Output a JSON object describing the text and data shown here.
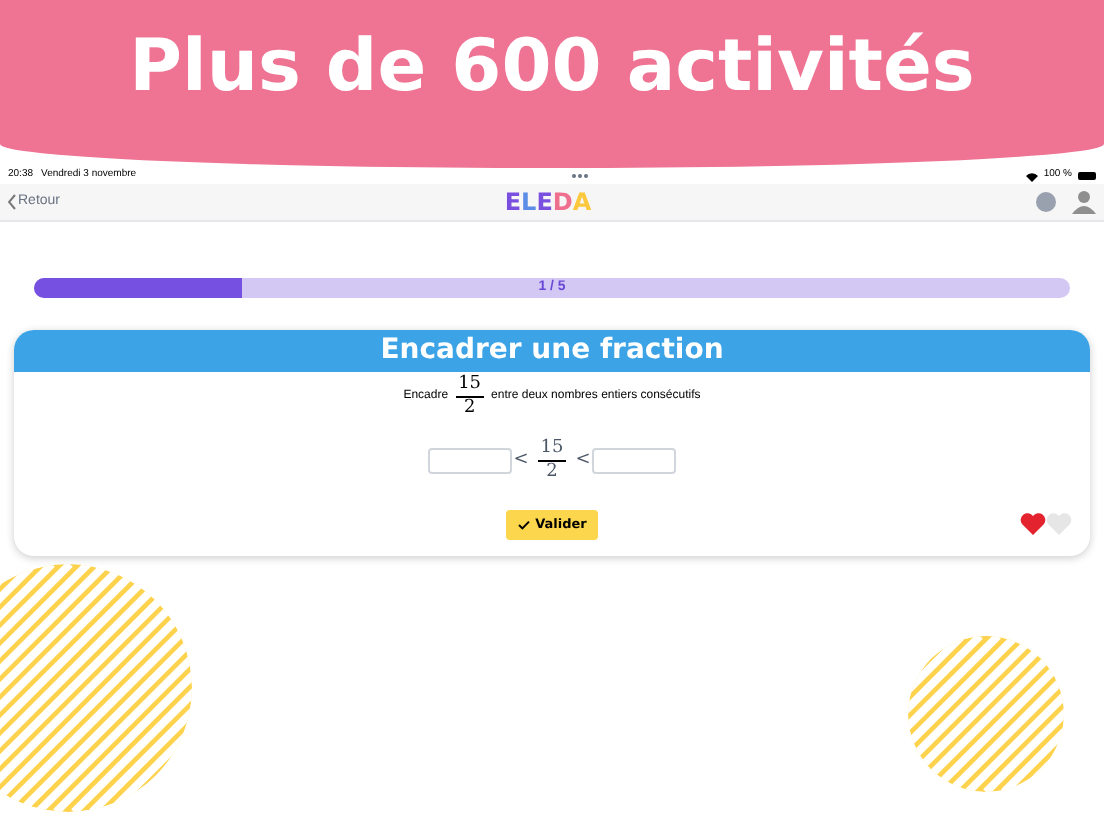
{
  "banner": {
    "title": "Plus de 600 activités"
  },
  "status_bar": {
    "time": "20:38",
    "date": "Vendredi 3 novembre",
    "battery": "100 %"
  },
  "nav": {
    "back": "Retour",
    "logo": "ELEDA"
  },
  "progress": {
    "label": "1 / 5",
    "level": 0.2
  },
  "card": {
    "title": "Encadrer une fraction",
    "instruction": {
      "before": "Encadre",
      "fraction": {
        "numerator": "15",
        "denominator": "2"
      },
      "after": "entre deux nombres entiers consécutifs"
    },
    "inequality": {
      "left_sign": "<",
      "fraction": {
        "numerator": "15",
        "denominator": "2"
      },
      "right_sign": "<"
    },
    "validate": "Valider",
    "lives": [
      {
        "filled": true
      },
      {
        "filled": false
      }
    ]
  }
}
